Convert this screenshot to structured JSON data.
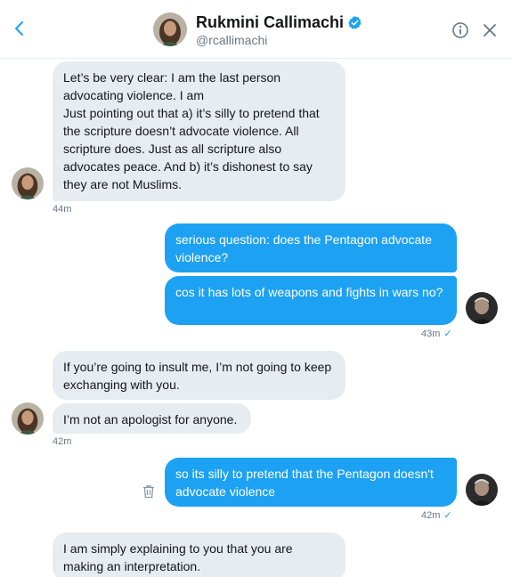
{
  "header": {
    "name": "Rukmini Callimachi",
    "handle": "@rcallimachi"
  },
  "colors": {
    "accent": "#1da1f2",
    "incoming_bubble": "#e6ecf0",
    "secondary_text": "#657786"
  },
  "icons": {
    "back": "chevron-left-icon",
    "verified": "verified-badge-icon",
    "info": "info-icon",
    "close": "close-icon",
    "delete": "trash-icon",
    "sent": "check-icon"
  },
  "messages": [
    {
      "direction": "in",
      "text": "Let’s be very clear: I am the last person advocating violence. I am\nJust pointing out that a) it’s silly to pretend that the scripture doesn’t advocate violence. All scripture does. Just as all scripture also advocates peace. And b) it’s dishonest to say they are not Muslims."
    },
    {
      "direction": "in",
      "timestamp": "44m"
    },
    {
      "direction": "out",
      "text": "serious question: does the Pentagon advocate violence?"
    },
    {
      "direction": "out",
      "text": "cos it has lots of weapons and fights in wars no?"
    },
    {
      "direction": "out",
      "timestamp": "43m"
    },
    {
      "direction": "in",
      "text": "If you’re going to insult me, I’m not going to keep exchanging with you."
    },
    {
      "direction": "in",
      "text": "I’m not an apologist for anyone."
    },
    {
      "direction": "in",
      "timestamp": "42m"
    },
    {
      "direction": "out",
      "text": "so its silly to pretend that the Pentagon doesn't advocate violence"
    },
    {
      "direction": "out",
      "timestamp": "42m"
    },
    {
      "direction": "in",
      "text": "I am simply explaining to you that you are making an interpretation."
    }
  ]
}
